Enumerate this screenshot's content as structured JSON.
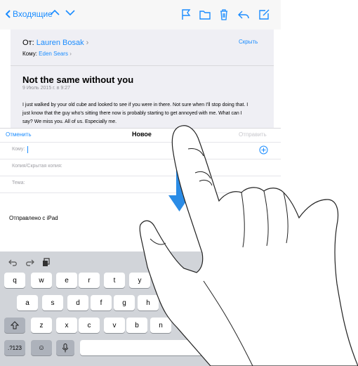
{
  "toolbar": {
    "back_label": "Входящие",
    "icons": [
      "chevron-up-icon",
      "chevron-down-icon",
      "flag-icon",
      "folder-icon",
      "trash-icon",
      "reply-icon",
      "compose-icon"
    ]
  },
  "message": {
    "from_prefix": "От:",
    "from_name": "Lauren Bosak",
    "to_prefix": "Кому:",
    "to_name": "Eden Sears",
    "hide_label": "Скрыть",
    "subject": "Not the same without you",
    "date": "9 Июль 2015 г. в 9:27",
    "body_lines": [
      "I just walked by your old cube and looked to see if you were in there. Not sure when I'll stop doing that. I",
      "just know that the guy who's sitting there now is probably starting to get annoyed with me. What can I",
      "say? We miss you. All of us. Especially me."
    ]
  },
  "compose": {
    "cancel_label": "Отменить",
    "title": "Новое",
    "send_label": "Отправить",
    "to_label": "Кому:",
    "cc_label": "Копия/Скрытая копия:",
    "subject_label": "Тема:",
    "signature": "Отправлено с iPad"
  },
  "keyboard": {
    "row1": [
      "q",
      "w",
      "e",
      "r",
      "t",
      "y"
    ],
    "row2": [
      "a",
      "s",
      "d",
      "f",
      "g",
      "h"
    ],
    "row3": [
      "z",
      "x",
      "c",
      "v",
      "b",
      "n"
    ],
    "numbers_label": ".?123",
    "emoji_label": "☺",
    "mic_label": "🎤",
    "underscore_label": "_"
  },
  "colors": {
    "accent": "#1a8cff",
    "arrow": "#2b8ce6",
    "keyboard_bg": "#d1d4d9"
  }
}
